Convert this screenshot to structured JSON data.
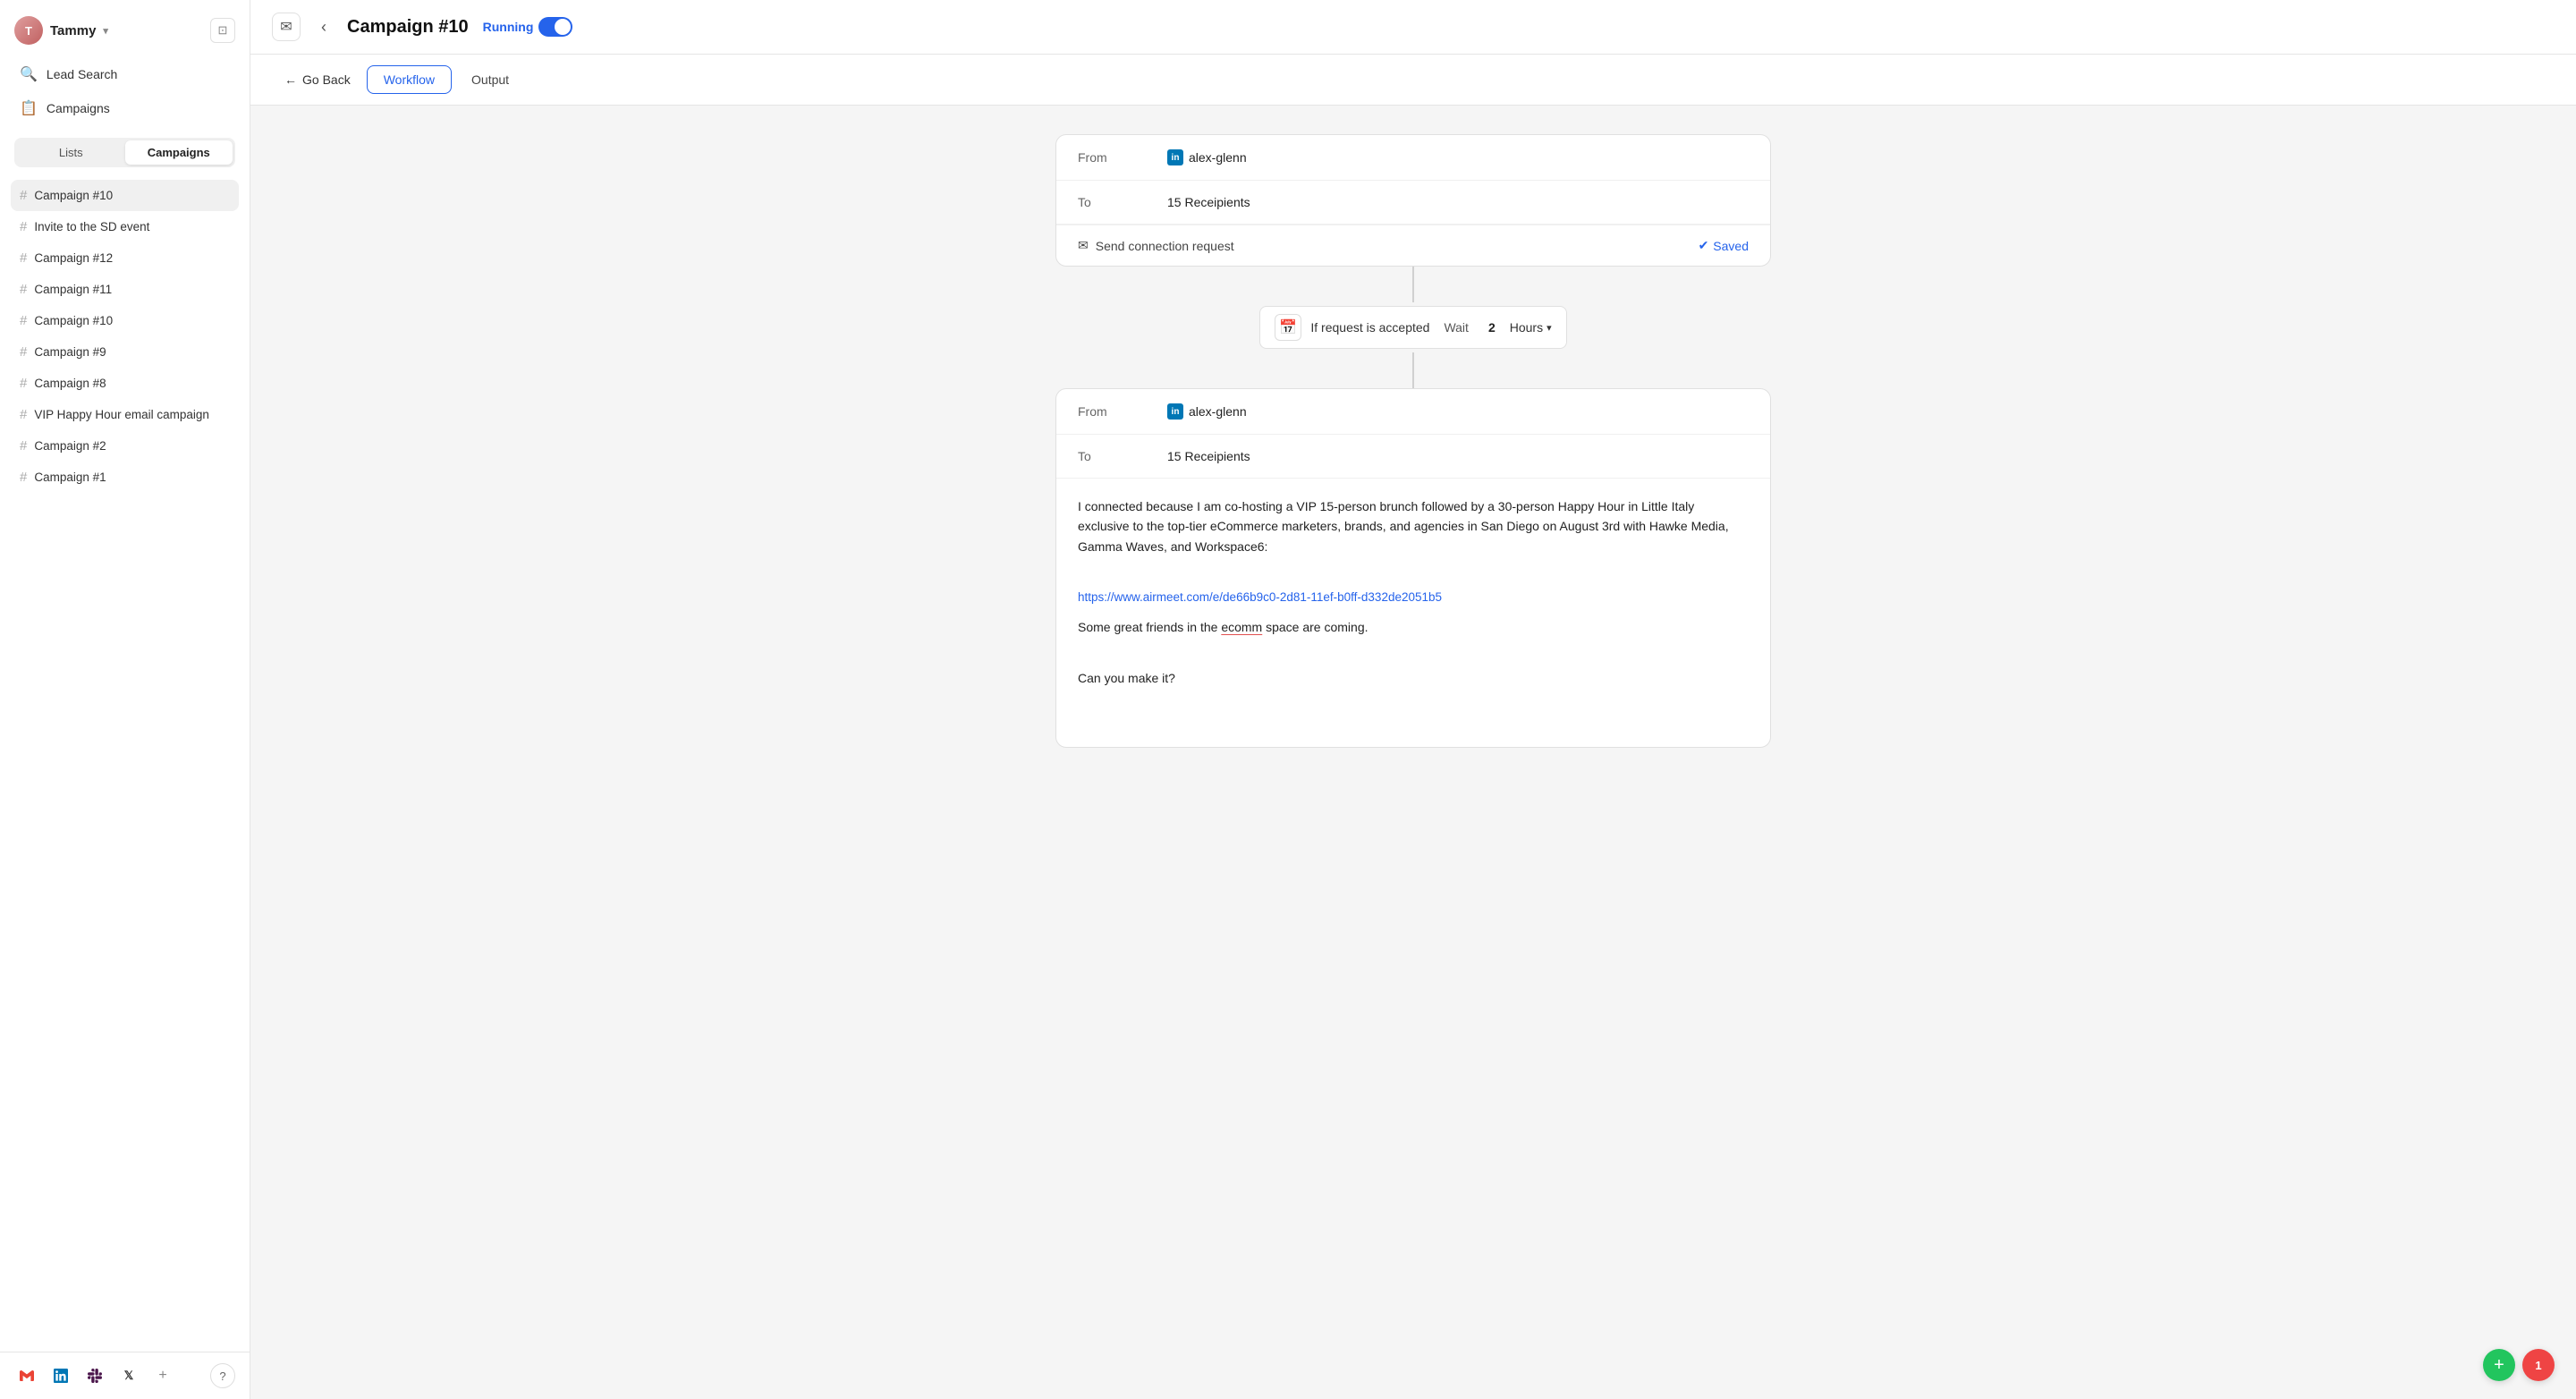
{
  "sidebar": {
    "user": {
      "name": "Tammy",
      "avatar_initials": "T"
    },
    "nav_items": [
      {
        "label": "Lead Search",
        "icon": "🔍"
      },
      {
        "label": "Campaigns",
        "icon": "📋"
      }
    ],
    "tabs": [
      {
        "label": "Lists",
        "active": false
      },
      {
        "label": "Campaigns",
        "active": true
      }
    ],
    "campaigns": [
      {
        "label": "Campaign #10",
        "active": true
      },
      {
        "label": "Invite to the SD event",
        "active": false
      },
      {
        "label": "Campaign #12",
        "active": false
      },
      {
        "label": "Campaign #11",
        "active": false
      },
      {
        "label": "Campaign #10",
        "active": false
      },
      {
        "label": "Campaign #9",
        "active": false
      },
      {
        "label": "Campaign #8",
        "active": false
      },
      {
        "label": "VIP Happy Hour email campaign",
        "active": false
      },
      {
        "label": "Campaign #2",
        "active": false
      },
      {
        "label": "Campaign #1",
        "active": false
      }
    ],
    "bottom_icons": [
      "✉",
      "in",
      "slack",
      "𝕏",
      "+"
    ],
    "help_label": "?"
  },
  "topbar": {
    "campaign_title": "Campaign #10",
    "status_label": "Running",
    "toggle_on": true
  },
  "subtabs": {
    "go_back_label": "Go Back",
    "tabs": [
      {
        "label": "Workflow",
        "active": true
      },
      {
        "label": "Output",
        "active": false
      }
    ]
  },
  "step1_card": {
    "from_label": "From",
    "from_value": "alex-glenn",
    "to_label": "To",
    "to_value": "15 Receipients",
    "action_icon": "✉",
    "action_label": "Send connection request",
    "saved_label": "Saved"
  },
  "connector": {
    "condition_label": "If request is accepted",
    "wait_label": "Wait",
    "wait_number": "2",
    "unit_label": "Hours"
  },
  "step2_card": {
    "from_label": "From",
    "from_value": "alex-glenn",
    "to_label": "To",
    "to_value": "15 Receipients",
    "message_body_parts": [
      "I connected because I am co-hosting a VIP 15-person brunch followed by a 30-person Happy Hour in Little Italy exclusive to the top-tier eCommerce marketers, brands, and agencies in San Diego on August 3rd with Hawke Media, Gamma Waves, and Workspace6:",
      "https://www.airmeet.com/e/de66b9c0-2d81-11ef-b0ff-d332de2051b5",
      "Some great friends in the ecomm space are coming.",
      "Can you make it?"
    ],
    "underline_word": "ecomm"
  },
  "bottom_actions": {
    "add_icon": "+",
    "count_badge": "1"
  }
}
